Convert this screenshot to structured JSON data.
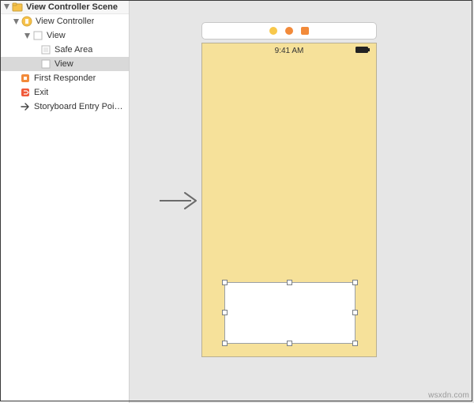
{
  "outline": {
    "scene_header": "View Controller Scene",
    "view_controller": "View Controller",
    "root_view": "View",
    "safe_area": "Safe Area",
    "child_view": "View",
    "first_responder": "First Responder",
    "exit": "Exit",
    "entry_point": "Storyboard Entry Poi…"
  },
  "canvas": {
    "status_time": "9:41 AM",
    "device_bg": "#f6e19a"
  },
  "watermark": "wsxdn.com"
}
